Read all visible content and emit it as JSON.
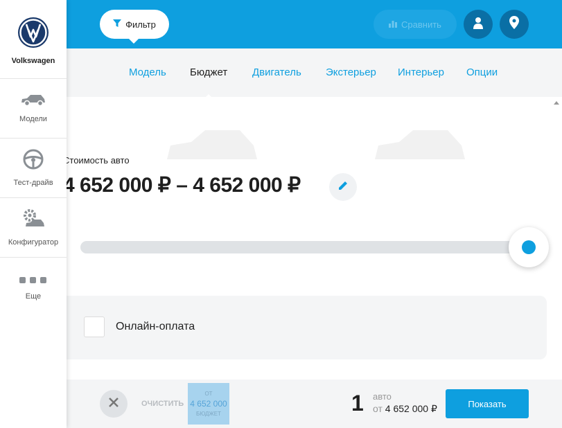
{
  "sidebar": {
    "brand": "Volkswagen",
    "items": [
      {
        "label": "Модели",
        "icon": "car-icon"
      },
      {
        "label": "Тест-драйв",
        "icon": "steering-wheel-icon"
      },
      {
        "label": "Конфигуратор",
        "icon": "configurator-icon"
      },
      {
        "label": "Еще",
        "icon": "more-dots-icon"
      }
    ]
  },
  "header": {
    "filter_label": "Фильтр",
    "compare_label": "Сравнить"
  },
  "tabs": [
    {
      "label": "Модель",
      "active": false
    },
    {
      "label": "Бюджет",
      "active": true
    },
    {
      "label": "Двигатель",
      "active": false
    },
    {
      "label": "Экстерьер",
      "active": false
    },
    {
      "label": "Интерьер",
      "active": false
    },
    {
      "label": "Опции",
      "active": false
    }
  ],
  "budget": {
    "label": "Стоимость авто",
    "range": "4 652 000 ₽ – 4 652 000 ₽"
  },
  "online_payment": {
    "label": "Онлайн-оплата",
    "checked": false
  },
  "bottom": {
    "clear_label": "ОЧИСТИТЬ",
    "chip": {
      "top": "ОТ",
      "value": "4 652 000",
      "bottom": "БЮДЖЕТ"
    },
    "count": "1",
    "count_unit": "авто",
    "from_word": "от",
    "from_price": "4 652 000 ₽",
    "show_label": "Показать"
  },
  "colors": {
    "accent": "#0e9fdf",
    "dark_button": "#0a6fa5",
    "panel_bg": "#f4f5f6"
  }
}
